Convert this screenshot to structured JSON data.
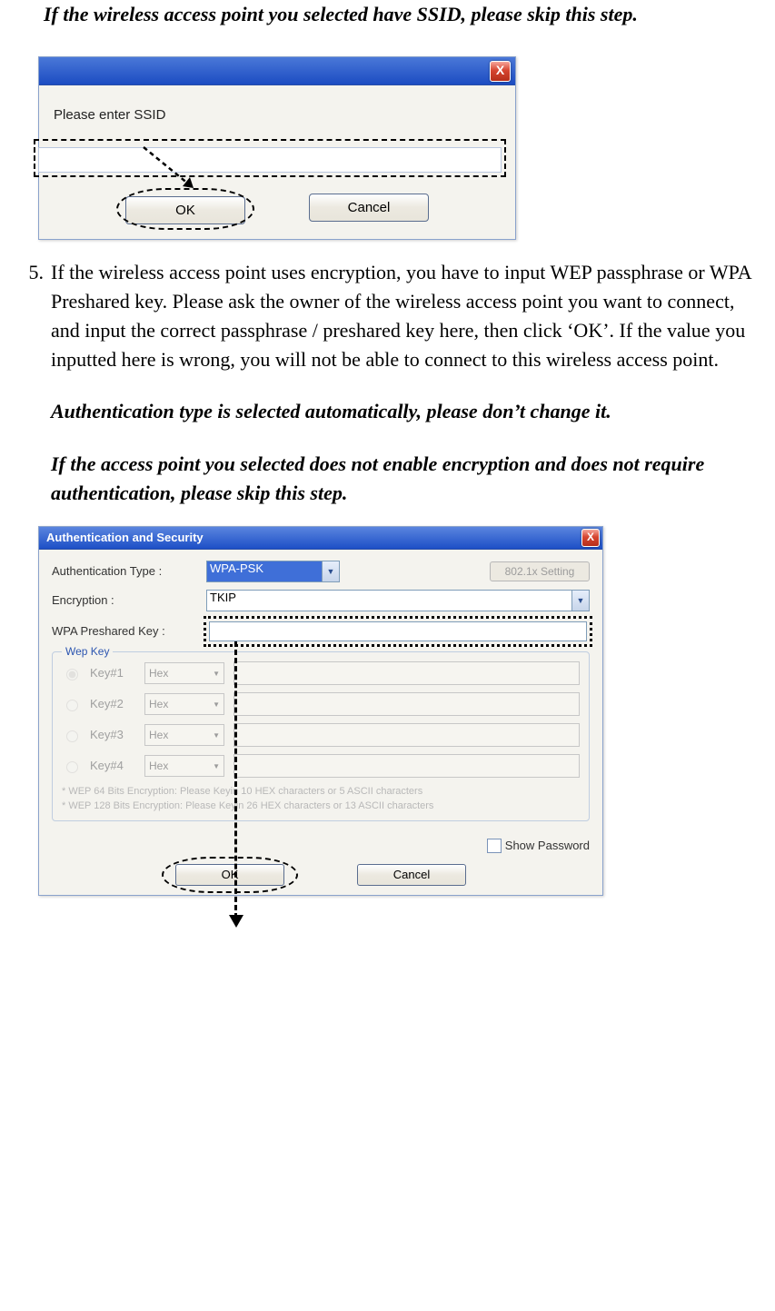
{
  "note1": "If the wireless access point you selected have SSID, please skip this step.",
  "dlg1": {
    "close": "X",
    "label": "Please enter SSID",
    "ssid_value": "",
    "ok": "OK",
    "cancel": "Cancel"
  },
  "step5": {
    "num": "5.",
    "text": "If the wireless access point uses encryption, you have to input WEP passphrase or WPA Preshared key. Please ask the owner of the wireless access point you want to connect, and input the correct passphrase / preshared key here, then click ‘OK’. If the value you inputted here is wrong, you will not be able to connect to this wireless access point.",
    "note2": "Authentication type is selected automatically, please don’t change it.",
    "note3": "If the access point you selected does not enable encryption and does not require authentication, please skip this step."
  },
  "dlg2": {
    "title": "Authentication and Security",
    "close": "X",
    "auth_label": "Authentication Type :",
    "auth_value": "WPA-PSK",
    "btn_8021x": "802.1x Setting",
    "enc_label": "Encryption :",
    "enc_value": "TKIP",
    "psk_label": "WPA Preshared Key :",
    "psk_value": "",
    "wep_legend": "Wep Key",
    "wep_keys": [
      {
        "label": "Key#1",
        "fmt": "Hex",
        "checked": true
      },
      {
        "label": "Key#2",
        "fmt": "Hex",
        "checked": false
      },
      {
        "label": "Key#3",
        "fmt": "Hex",
        "checked": false
      },
      {
        "label": "Key#4",
        "fmt": "Hex",
        "checked": false
      }
    ],
    "hint1": "* WEP 64 Bits Encryption: Please Keyin 10 HEX characters or 5 ASCII characters",
    "hint2": "* WEP 128 Bits Encryption: Please Keyin 26 HEX characters or 13 ASCII characters",
    "show_pwd": "Show Password",
    "ok": "OK",
    "cancel": "Cancel",
    "dropdown_glyph": "▼"
  }
}
